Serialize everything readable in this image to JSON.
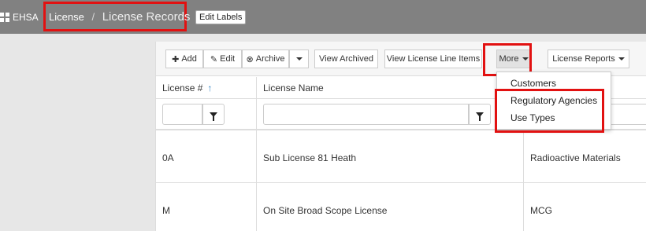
{
  "header": {
    "brand": "EHSA",
    "breadcrumb": {
      "root": "License",
      "separator": "/",
      "current": "License Records"
    },
    "edit_labels": "Edit Labels"
  },
  "toolbar": {
    "add": "Add",
    "edit": "Edit",
    "archive": "Archive",
    "view_archived": "View Archived",
    "view_line_items": "View License Line Items",
    "more": "More",
    "license_reports": "License Reports"
  },
  "table": {
    "columns": [
      "License #",
      "License Name"
    ],
    "sort_indicator": "↑",
    "rows": [
      {
        "license_no": "0A",
        "license_name": "Sub License 81 Heath",
        "type": "Radioactive Materials"
      },
      {
        "license_no": "M",
        "license_name": "On Site Broad Scope License",
        "type": "MCG"
      }
    ]
  },
  "more_menu": {
    "items": [
      "Customers",
      "Regulatory Agencies",
      "Use Types"
    ]
  },
  "colors": {
    "highlight": "#e21111",
    "topbar": "#818181",
    "sort_arrow": "#2a7fc1"
  }
}
